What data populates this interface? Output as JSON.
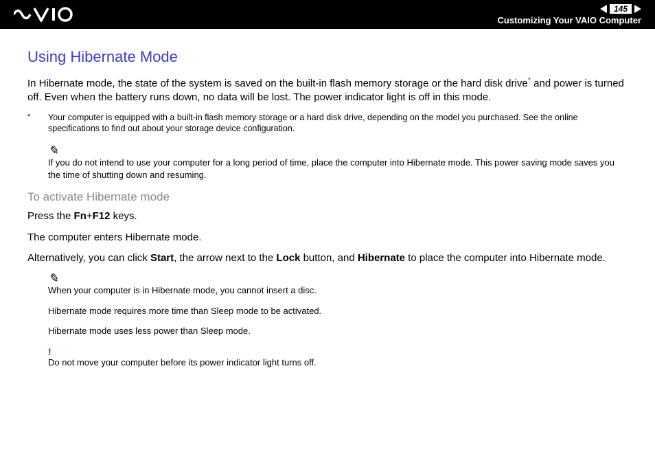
{
  "header": {
    "page_number": "145",
    "breadcrumb": "Customizing Your VAIO Computer"
  },
  "main_heading": "Using Hibernate Mode",
  "intro_text_before_sup": "In Hibernate mode, the state of the system is saved on the built-in flash memory storage or the hard disk drive",
  "intro_sup": "*",
  "intro_text_after_sup": " and power is turned off. Even when the battery runs down, no data will be lost. The power indicator light is off in this mode.",
  "footnote_marker": "*",
  "footnote_text": "Your computer is equipped with a built-in flash memory storage or a hard disk drive, depending on the model you purchased. See the online specifications to find out about your storage device configuration.",
  "tip1": "If you do not intend to use your computer for a long period of time, place the computer into Hibernate mode. This power saving mode saves you the time of shutting down and resuming.",
  "sub_heading": "To activate Hibernate mode",
  "press_text_pre": "Press the ",
  "press_key1": "Fn",
  "press_plus": "+",
  "press_key2": "F12",
  "press_text_post": " keys.",
  "enters_text": "The computer enters Hibernate mode.",
  "alt_pre": "Alternatively, you can click ",
  "alt_start": "Start",
  "alt_mid1": ", the arrow next to the ",
  "alt_lock": "Lock",
  "alt_mid2": " button, and ",
  "alt_hibernate": "Hibernate",
  "alt_post": " to place the computer into Hibernate mode.",
  "tip2a": "When your computer is in Hibernate mode, you cannot insert a disc.",
  "tip2b": "Hibernate mode requires more time than Sleep mode to be activated.",
  "tip2c": "Hibernate mode uses less power than Sleep mode.",
  "warn_text": "Do not move your computer before its power indicator light turns off."
}
